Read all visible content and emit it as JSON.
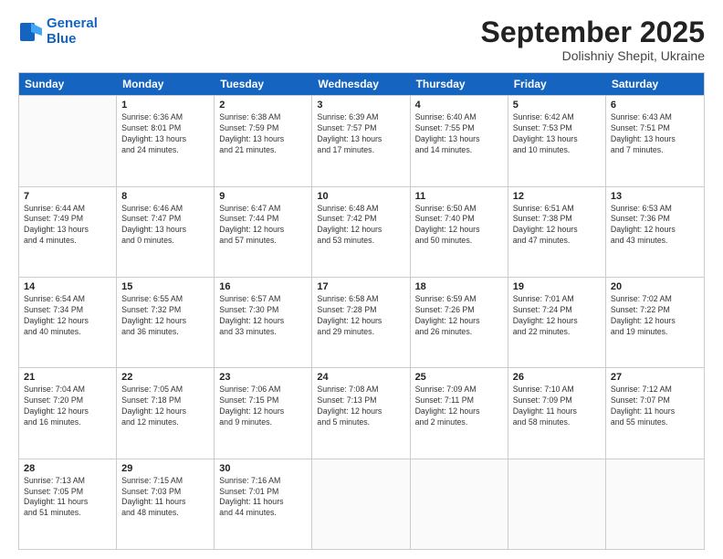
{
  "header": {
    "logo_line1": "General",
    "logo_line2": "Blue",
    "month": "September 2025",
    "location": "Dolishniy Shepit, Ukraine"
  },
  "weekdays": [
    "Sunday",
    "Monday",
    "Tuesday",
    "Wednesday",
    "Thursday",
    "Friday",
    "Saturday"
  ],
  "rows": [
    [
      {
        "day": "",
        "info": ""
      },
      {
        "day": "1",
        "info": "Sunrise: 6:36 AM\nSunset: 8:01 PM\nDaylight: 13 hours\nand 24 minutes."
      },
      {
        "day": "2",
        "info": "Sunrise: 6:38 AM\nSunset: 7:59 PM\nDaylight: 13 hours\nand 21 minutes."
      },
      {
        "day": "3",
        "info": "Sunrise: 6:39 AM\nSunset: 7:57 PM\nDaylight: 13 hours\nand 17 minutes."
      },
      {
        "day": "4",
        "info": "Sunrise: 6:40 AM\nSunset: 7:55 PM\nDaylight: 13 hours\nand 14 minutes."
      },
      {
        "day": "5",
        "info": "Sunrise: 6:42 AM\nSunset: 7:53 PM\nDaylight: 13 hours\nand 10 minutes."
      },
      {
        "day": "6",
        "info": "Sunrise: 6:43 AM\nSunset: 7:51 PM\nDaylight: 13 hours\nand 7 minutes."
      }
    ],
    [
      {
        "day": "7",
        "info": "Sunrise: 6:44 AM\nSunset: 7:49 PM\nDaylight: 13 hours\nand 4 minutes."
      },
      {
        "day": "8",
        "info": "Sunrise: 6:46 AM\nSunset: 7:47 PM\nDaylight: 13 hours\nand 0 minutes."
      },
      {
        "day": "9",
        "info": "Sunrise: 6:47 AM\nSunset: 7:44 PM\nDaylight: 12 hours\nand 57 minutes."
      },
      {
        "day": "10",
        "info": "Sunrise: 6:48 AM\nSunset: 7:42 PM\nDaylight: 12 hours\nand 53 minutes."
      },
      {
        "day": "11",
        "info": "Sunrise: 6:50 AM\nSunset: 7:40 PM\nDaylight: 12 hours\nand 50 minutes."
      },
      {
        "day": "12",
        "info": "Sunrise: 6:51 AM\nSunset: 7:38 PM\nDaylight: 12 hours\nand 47 minutes."
      },
      {
        "day": "13",
        "info": "Sunrise: 6:53 AM\nSunset: 7:36 PM\nDaylight: 12 hours\nand 43 minutes."
      }
    ],
    [
      {
        "day": "14",
        "info": "Sunrise: 6:54 AM\nSunset: 7:34 PM\nDaylight: 12 hours\nand 40 minutes."
      },
      {
        "day": "15",
        "info": "Sunrise: 6:55 AM\nSunset: 7:32 PM\nDaylight: 12 hours\nand 36 minutes."
      },
      {
        "day": "16",
        "info": "Sunrise: 6:57 AM\nSunset: 7:30 PM\nDaylight: 12 hours\nand 33 minutes."
      },
      {
        "day": "17",
        "info": "Sunrise: 6:58 AM\nSunset: 7:28 PM\nDaylight: 12 hours\nand 29 minutes."
      },
      {
        "day": "18",
        "info": "Sunrise: 6:59 AM\nSunset: 7:26 PM\nDaylight: 12 hours\nand 26 minutes."
      },
      {
        "day": "19",
        "info": "Sunrise: 7:01 AM\nSunset: 7:24 PM\nDaylight: 12 hours\nand 22 minutes."
      },
      {
        "day": "20",
        "info": "Sunrise: 7:02 AM\nSunset: 7:22 PM\nDaylight: 12 hours\nand 19 minutes."
      }
    ],
    [
      {
        "day": "21",
        "info": "Sunrise: 7:04 AM\nSunset: 7:20 PM\nDaylight: 12 hours\nand 16 minutes."
      },
      {
        "day": "22",
        "info": "Sunrise: 7:05 AM\nSunset: 7:18 PM\nDaylight: 12 hours\nand 12 minutes."
      },
      {
        "day": "23",
        "info": "Sunrise: 7:06 AM\nSunset: 7:15 PM\nDaylight: 12 hours\nand 9 minutes."
      },
      {
        "day": "24",
        "info": "Sunrise: 7:08 AM\nSunset: 7:13 PM\nDaylight: 12 hours\nand 5 minutes."
      },
      {
        "day": "25",
        "info": "Sunrise: 7:09 AM\nSunset: 7:11 PM\nDaylight: 12 hours\nand 2 minutes."
      },
      {
        "day": "26",
        "info": "Sunrise: 7:10 AM\nSunset: 7:09 PM\nDaylight: 11 hours\nand 58 minutes."
      },
      {
        "day": "27",
        "info": "Sunrise: 7:12 AM\nSunset: 7:07 PM\nDaylight: 11 hours\nand 55 minutes."
      }
    ],
    [
      {
        "day": "28",
        "info": "Sunrise: 7:13 AM\nSunset: 7:05 PM\nDaylight: 11 hours\nand 51 minutes."
      },
      {
        "day": "29",
        "info": "Sunrise: 7:15 AM\nSunset: 7:03 PM\nDaylight: 11 hours\nand 48 minutes."
      },
      {
        "day": "30",
        "info": "Sunrise: 7:16 AM\nSunset: 7:01 PM\nDaylight: 11 hours\nand 44 minutes."
      },
      {
        "day": "",
        "info": ""
      },
      {
        "day": "",
        "info": ""
      },
      {
        "day": "",
        "info": ""
      },
      {
        "day": "",
        "info": ""
      }
    ]
  ]
}
